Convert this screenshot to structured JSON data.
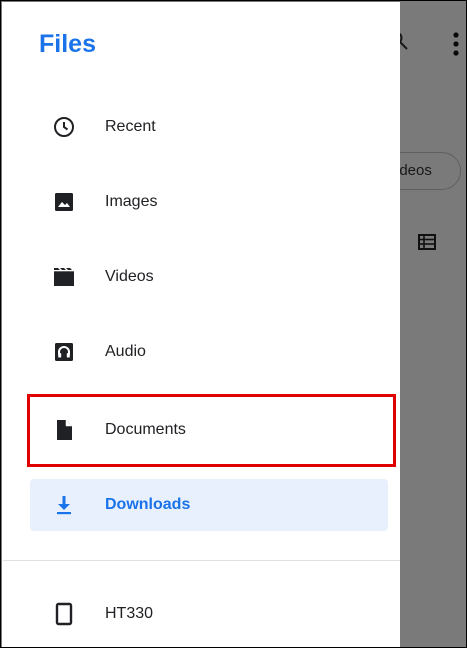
{
  "drawer": {
    "title": "Files",
    "items": [
      {
        "label": "Recent",
        "icon": "clock-icon"
      },
      {
        "label": "Images",
        "icon": "image-icon"
      },
      {
        "label": "Videos",
        "icon": "video-icon"
      },
      {
        "label": "Audio",
        "icon": "audio-icon"
      },
      {
        "label": "Documents",
        "icon": "document-icon"
      },
      {
        "label": "Downloads",
        "icon": "download-icon",
        "selected": true
      }
    ],
    "devices": [
      {
        "label": "HT330",
        "icon": "phone-icon"
      }
    ]
  },
  "background": {
    "chip_label": "ideos"
  },
  "colors": {
    "accent": "#1a73e8",
    "selected_bg": "#e8f0fe",
    "highlight": "#e00000"
  }
}
